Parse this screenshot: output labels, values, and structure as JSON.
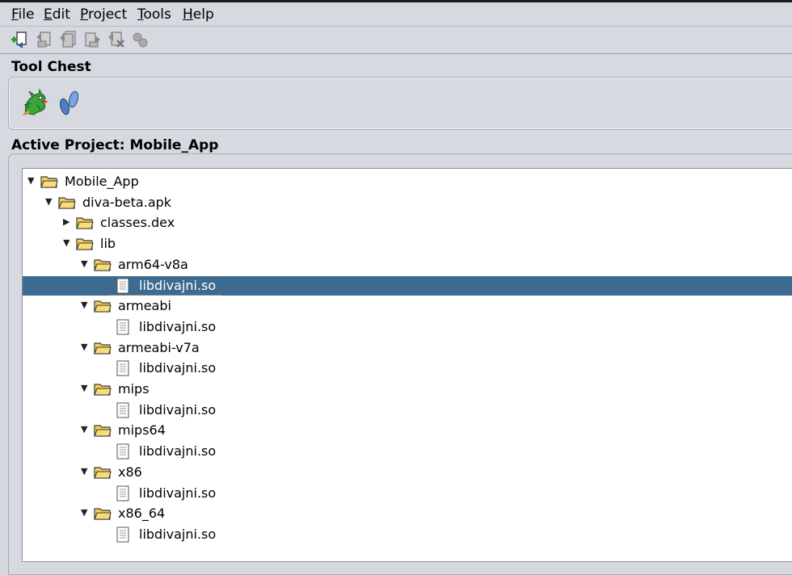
{
  "menu": {
    "file": {
      "u": "F",
      "rest": "ile"
    },
    "edit": {
      "u": "E",
      "rest": "dit"
    },
    "project": {
      "u": "P",
      "rest": "roject"
    },
    "tools": {
      "u": "T",
      "rest": "ools"
    },
    "help": {
      "u": "H",
      "rest": "elp"
    }
  },
  "toolbar": {
    "icons": [
      "new-project-icon",
      "import-icon",
      "batch-import-icon",
      "export-icon",
      "delete-icon",
      "link-icon"
    ]
  },
  "tool_chest": {
    "title": "Tool Chest",
    "tools": [
      "dragon-code-browser-icon",
      "footprints-debugger-icon"
    ]
  },
  "project": {
    "title": "Active Project: Mobile_App",
    "tree": [
      {
        "label": "Mobile_App",
        "type": "folder",
        "state": "expanded",
        "depth": 0
      },
      {
        "label": "diva-beta.apk",
        "type": "folder",
        "state": "expanded",
        "depth": 1
      },
      {
        "label": "classes.dex",
        "type": "folder",
        "state": "collapsed",
        "depth": 2
      },
      {
        "label": "lib",
        "type": "folder",
        "state": "expanded",
        "depth": 2
      },
      {
        "label": "arm64-v8a",
        "type": "folder",
        "state": "expanded",
        "depth": 3
      },
      {
        "label": "libdivajni.so",
        "type": "file",
        "depth": 4,
        "selected": true
      },
      {
        "label": "armeabi",
        "type": "folder",
        "state": "expanded",
        "depth": 3
      },
      {
        "label": "libdivajni.so",
        "type": "file",
        "depth": 4
      },
      {
        "label": "armeabi-v7a",
        "type": "folder",
        "state": "expanded",
        "depth": 3
      },
      {
        "label": "libdivajni.so",
        "type": "file",
        "depth": 4
      },
      {
        "label": "mips",
        "type": "folder",
        "state": "expanded",
        "depth": 3
      },
      {
        "label": "libdivajni.so",
        "type": "file",
        "depth": 4
      },
      {
        "label": "mips64",
        "type": "folder",
        "state": "expanded",
        "depth": 3
      },
      {
        "label": "libdivajni.so",
        "type": "file",
        "depth": 4
      },
      {
        "label": "x86",
        "type": "folder",
        "state": "expanded",
        "depth": 3
      },
      {
        "label": "libdivajni.so",
        "type": "file",
        "depth": 4
      },
      {
        "label": "x86_64",
        "type": "folder",
        "state": "expanded",
        "depth": 3
      },
      {
        "label": "libdivajni.so",
        "type": "file",
        "depth": 4
      }
    ]
  },
  "colors": {
    "background": "#d6d9df",
    "selection": "#3d6a90",
    "folder": "#f2cf55"
  }
}
